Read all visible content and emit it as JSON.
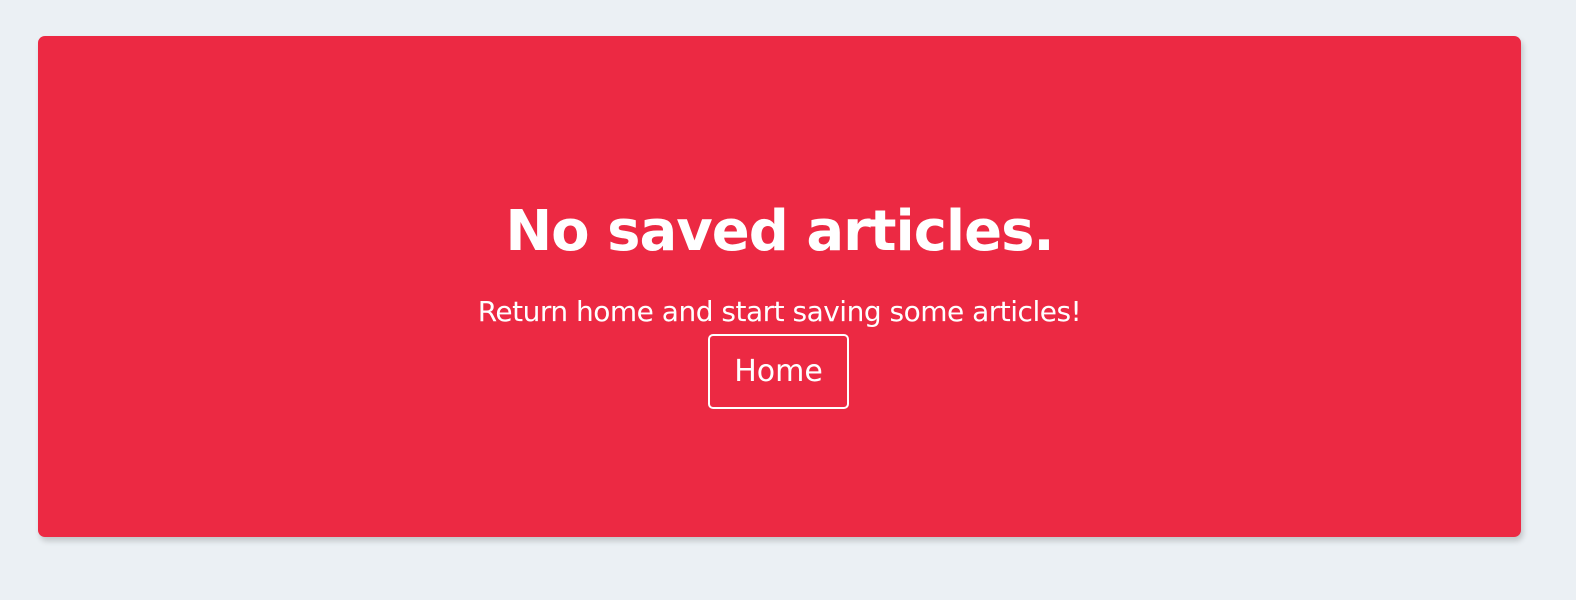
{
  "empty_state": {
    "title": "No saved articles.",
    "subtitle": "Return home and start saving some articles!",
    "home_button_label": "Home",
    "background_color": "#ec2943",
    "text_color": "#ffffff"
  },
  "page": {
    "background_color": "#ebf0f4"
  }
}
